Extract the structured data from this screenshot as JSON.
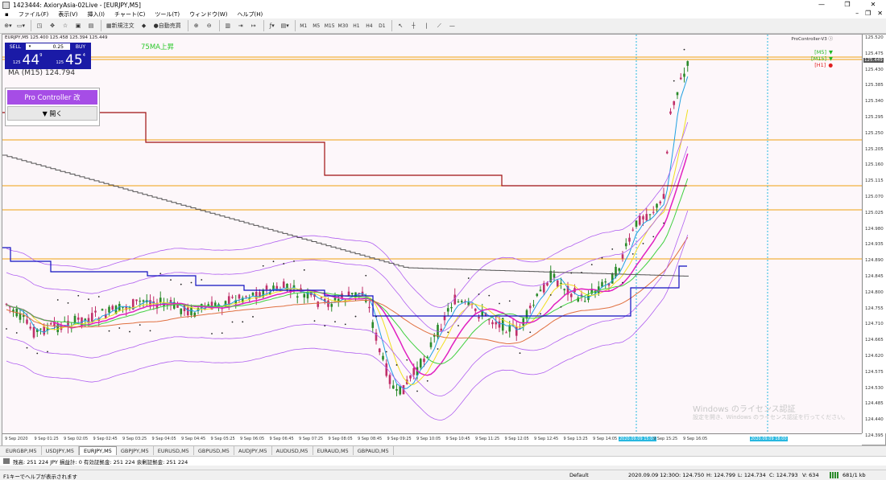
{
  "window": {
    "title": "1423444: AxioryAsia-02Live - [EURJPY,M5]"
  },
  "menu": [
    "ファイル(F)",
    "表示(V)",
    "挿入(I)",
    "チャート(C)",
    "ツール(T)",
    "ウィンドウ(W)",
    "ヘルプ(H)"
  ],
  "toolbar": {
    "new_order": "新規注文",
    "auto_trade": "自動売買",
    "timeframes": [
      "M1",
      "M5",
      "M15",
      "M30",
      "H1",
      "H4",
      "D1"
    ]
  },
  "chart": {
    "header": "EURJPY,M5  125.400 125.458 125.394 125.449",
    "trade_panel": {
      "sell": "SELL",
      "buy": "BUY",
      "lot": "0.25",
      "sell_small": "125",
      "sell_big": "44",
      "sell_sup": "9",
      "buy_small": "125",
      "buy_big": "45",
      "buy_sup": "4"
    },
    "ma_label": "MA (M15) 124.794",
    "pro_controller": {
      "title": "Pro Controller 改",
      "open": "▼ 開く"
    },
    "ma75_label": "75MA上昇",
    "controller_name": "ProController-V3",
    "signals": [
      {
        "label": "[M5]",
        "color": "#22b822",
        "arrow": "down"
      },
      {
        "label": "[M15]",
        "color": "#22b822",
        "arrow": "down"
      },
      {
        "label": "[H1]",
        "color": "#e02020",
        "arrow": "dot"
      }
    ],
    "price_labels": [
      "125.520",
      "125.475",
      "125.430",
      "125.385",
      "125.340",
      "125.295",
      "125.250",
      "125.205",
      "125.160",
      "125.115",
      "125.070",
      "125.025",
      "124.980",
      "124.935",
      "124.890",
      "124.845",
      "124.800",
      "124.755",
      "124.710",
      "124.665",
      "124.620",
      "124.575",
      "124.530",
      "124.485",
      "124.440",
      "124.395"
    ],
    "current_price": "125.449",
    "time_labels": [
      "9 Sep 2020",
      "9 Sep 01:25",
      "9 Sep 02:05",
      "9 Sep 02:45",
      "9 Sep 03:25",
      "9 Sep 04:05",
      "9 Sep 04:45",
      "9 Sep 05:25",
      "9 Sep 06:05",
      "9 Sep 06:45",
      "9 Sep 07:25",
      "9 Sep 08:05",
      "9 Sep 08:45",
      "9 Sep 09:25",
      "9 Sep 10:05",
      "9 Sep 10:45",
      "9 Sep 11:25",
      "9 Sep 12:05",
      "9 Sep 12:45",
      "9 Sep 13:25",
      "9 Sep 14:05",
      "2020.09.09 15:00",
      "9 Sep 15:25",
      "9 Sep 16:05",
      "2020.09.09 18:00"
    ],
    "watermark": "Windows のライセンス認証",
    "watermark2": "設定を開き、Windows のライセンス認証を行ってください。"
  },
  "tabs": [
    "EURGBP,M5",
    "USDJPY,M5",
    "EURJPY,M5",
    "GBPJPY,M5",
    "EURUSD,M5",
    "GBPUSD,M5",
    "AUDJPY,M5",
    "AUDUSD,M5",
    "EURAUD,M5",
    "GBPAUD,M5"
  ],
  "active_tab": "EURJPY,M5",
  "account": "残高: 251 224 JPY  損益計: 0  有効証拠金: 251 224  余剰証拠金: 251 224",
  "status": {
    "help": "F1キーでヘルプが表示されます",
    "profile": "Default",
    "time": "2020.09.09 12:30",
    "open": "O: 124.750",
    "high": "H: 124.799",
    "low": "L: 124.734",
    "close": "C: 124.793",
    "volume": "V: 634",
    "traffic": "681/1 kb"
  },
  "colors": {
    "sell_buy_bg": "#1a1aa6",
    "pro_controller": "#a64de6",
    "ma75": "#2bc82b",
    "hline": "#f0a010"
  }
}
